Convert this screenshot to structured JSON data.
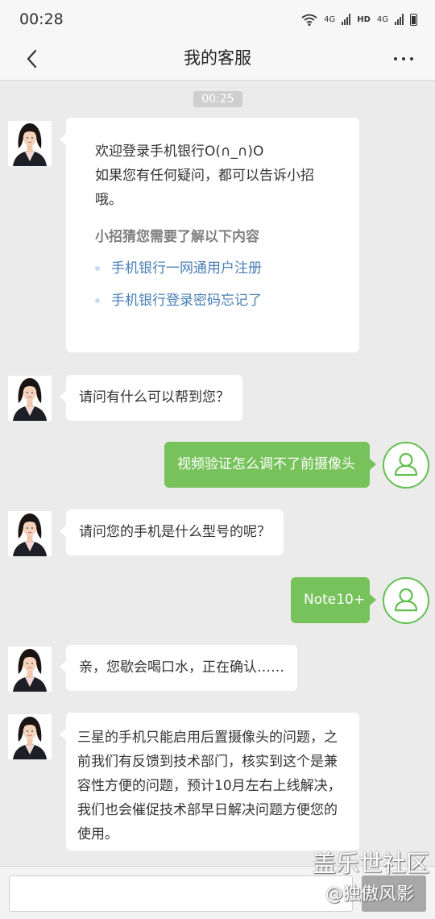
{
  "status_bar": {
    "time": "00:28",
    "net1": "4G",
    "hd": "HD",
    "net2": "4G"
  },
  "header": {
    "title": "我的客服",
    "back_icon": "chevron-left-icon",
    "more_icon": "more-dots-icon"
  },
  "timestamp": "00:25",
  "welcome": {
    "line1": "欢迎登录手机银行O(∩_∩)O",
    "line2": "如果您有任何疑问，都可以告诉小招哦。",
    "faq_title": "小招猜您需要了解以下内容",
    "faq_items": [
      "手机银行一网通用户注册",
      "手机银行登录密码忘记了"
    ]
  },
  "messages": [
    {
      "from": "agent",
      "text": "请问有什么可以帮到您？"
    },
    {
      "from": "user",
      "text": "视频验证怎么调不了前摄像头"
    },
    {
      "from": "agent",
      "text": "请问您的手机是什么型号的呢？"
    },
    {
      "from": "user",
      "text": "Note10+"
    },
    {
      "from": "agent",
      "text": "亲，您歇会喝口水，正在确认……"
    },
    {
      "from": "agent",
      "text": "三星的手机只能启用后置摄像头的问题，之前我们有反馈到技术部门，核实到这个是兼容性方便的问题，预计10月左右上线解决，我们也会催促技术部早日解决问题方便您的使用。"
    }
  ],
  "input": {
    "value": "",
    "placeholder": ""
  },
  "watermark": {
    "line1": "盖乐世社区",
    "line2": "@独傲风影"
  },
  "colors": {
    "user_bubble": "#77c25b",
    "link": "#4a7fb5",
    "background": "#ebebeb"
  }
}
